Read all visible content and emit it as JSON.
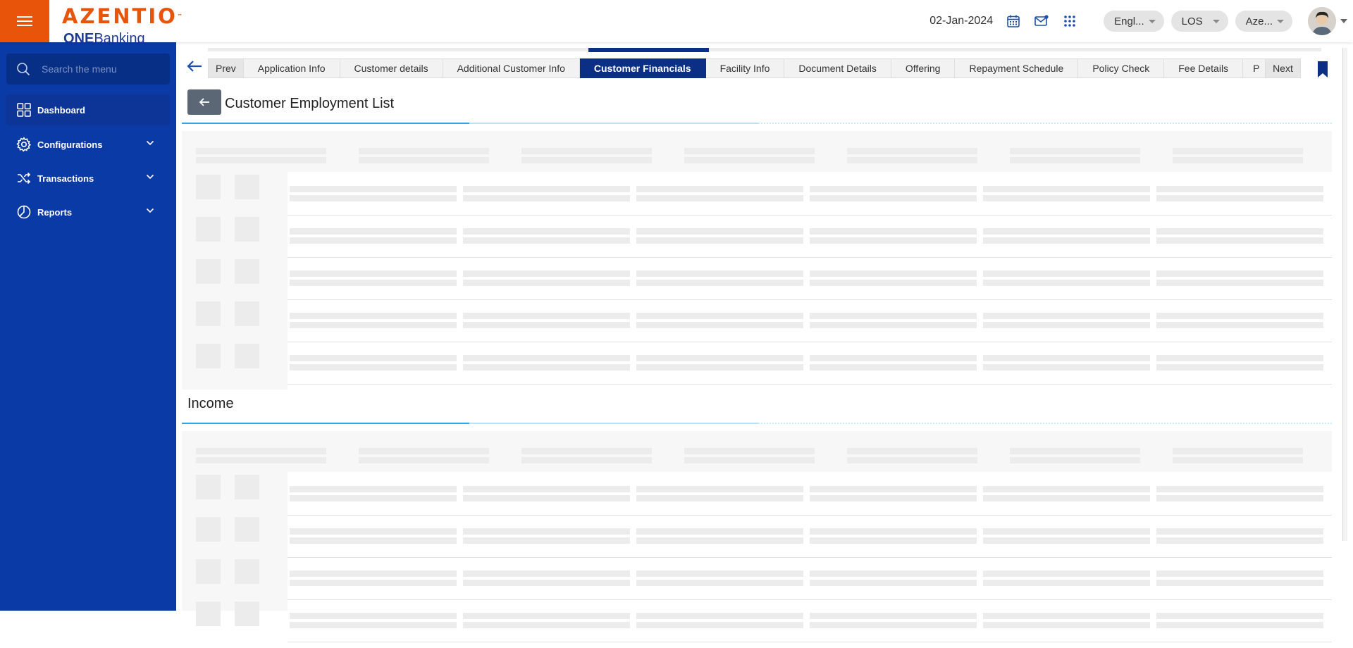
{
  "header": {
    "brand": "AZENTIO",
    "brand_tm": "™",
    "product_prefix": "ONE",
    "product_suffix": "Banking",
    "date": "02-Jan-2024",
    "language": "Engl...",
    "module": "LOS",
    "entity": "Aze...",
    "accent_color": "#e8540a"
  },
  "sidebar": {
    "search_placeholder": "Search the menu",
    "items": [
      {
        "label": "Dashboard",
        "icon": "dashboard-icon"
      },
      {
        "label": "Configurations",
        "icon": "gear-icon"
      },
      {
        "label": "Transactions",
        "icon": "shuffle-icon"
      },
      {
        "label": "Reports",
        "icon": "pie-chart-icon"
      }
    ],
    "bg_color": "#0a3aa6"
  },
  "tabs": {
    "prev": "Prev",
    "next": "Next",
    "items": [
      "Application Info",
      "Customer details",
      "Additional Customer Info",
      "Customer Financials",
      "Facility Info",
      "Document Details",
      "Offering",
      "Repayment Schedule",
      "Policy Check",
      "Fee Details",
      "P"
    ],
    "active": "Customer Financials"
  },
  "sections": {
    "employment_title": "Customer Employment List",
    "income_title": "Income"
  }
}
